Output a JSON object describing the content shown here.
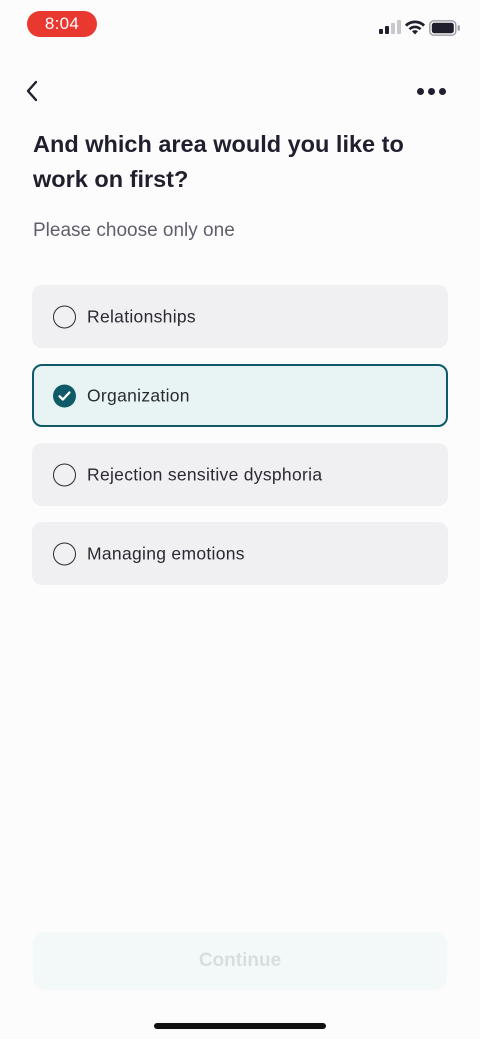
{
  "status_bar": {
    "time": "8:04",
    "icons": [
      "signal-icon",
      "wifi-icon",
      "battery-icon"
    ],
    "time_pill_color": "#e8382f"
  },
  "nav": {
    "back_icon": "chevron-left-icon",
    "more_icon": "more-horizontal-icon"
  },
  "question": {
    "title": "And which area would you like to work on first?",
    "subtitle": "Please choose only one"
  },
  "options": [
    {
      "label": "Relationships",
      "selected": false
    },
    {
      "label": "Organization",
      "selected": true
    },
    {
      "label": "Rejection sensitive dysphoria",
      "selected": false
    },
    {
      "label": "Managing emotions",
      "selected": false
    }
  ],
  "continue": {
    "label": "Continue",
    "enabled": false
  },
  "colors": {
    "accent": "#0e5a66",
    "selected_bg": "#e8f4f3",
    "option_bg": "#f0eff2",
    "disabled_text": "#d6dfdf"
  }
}
